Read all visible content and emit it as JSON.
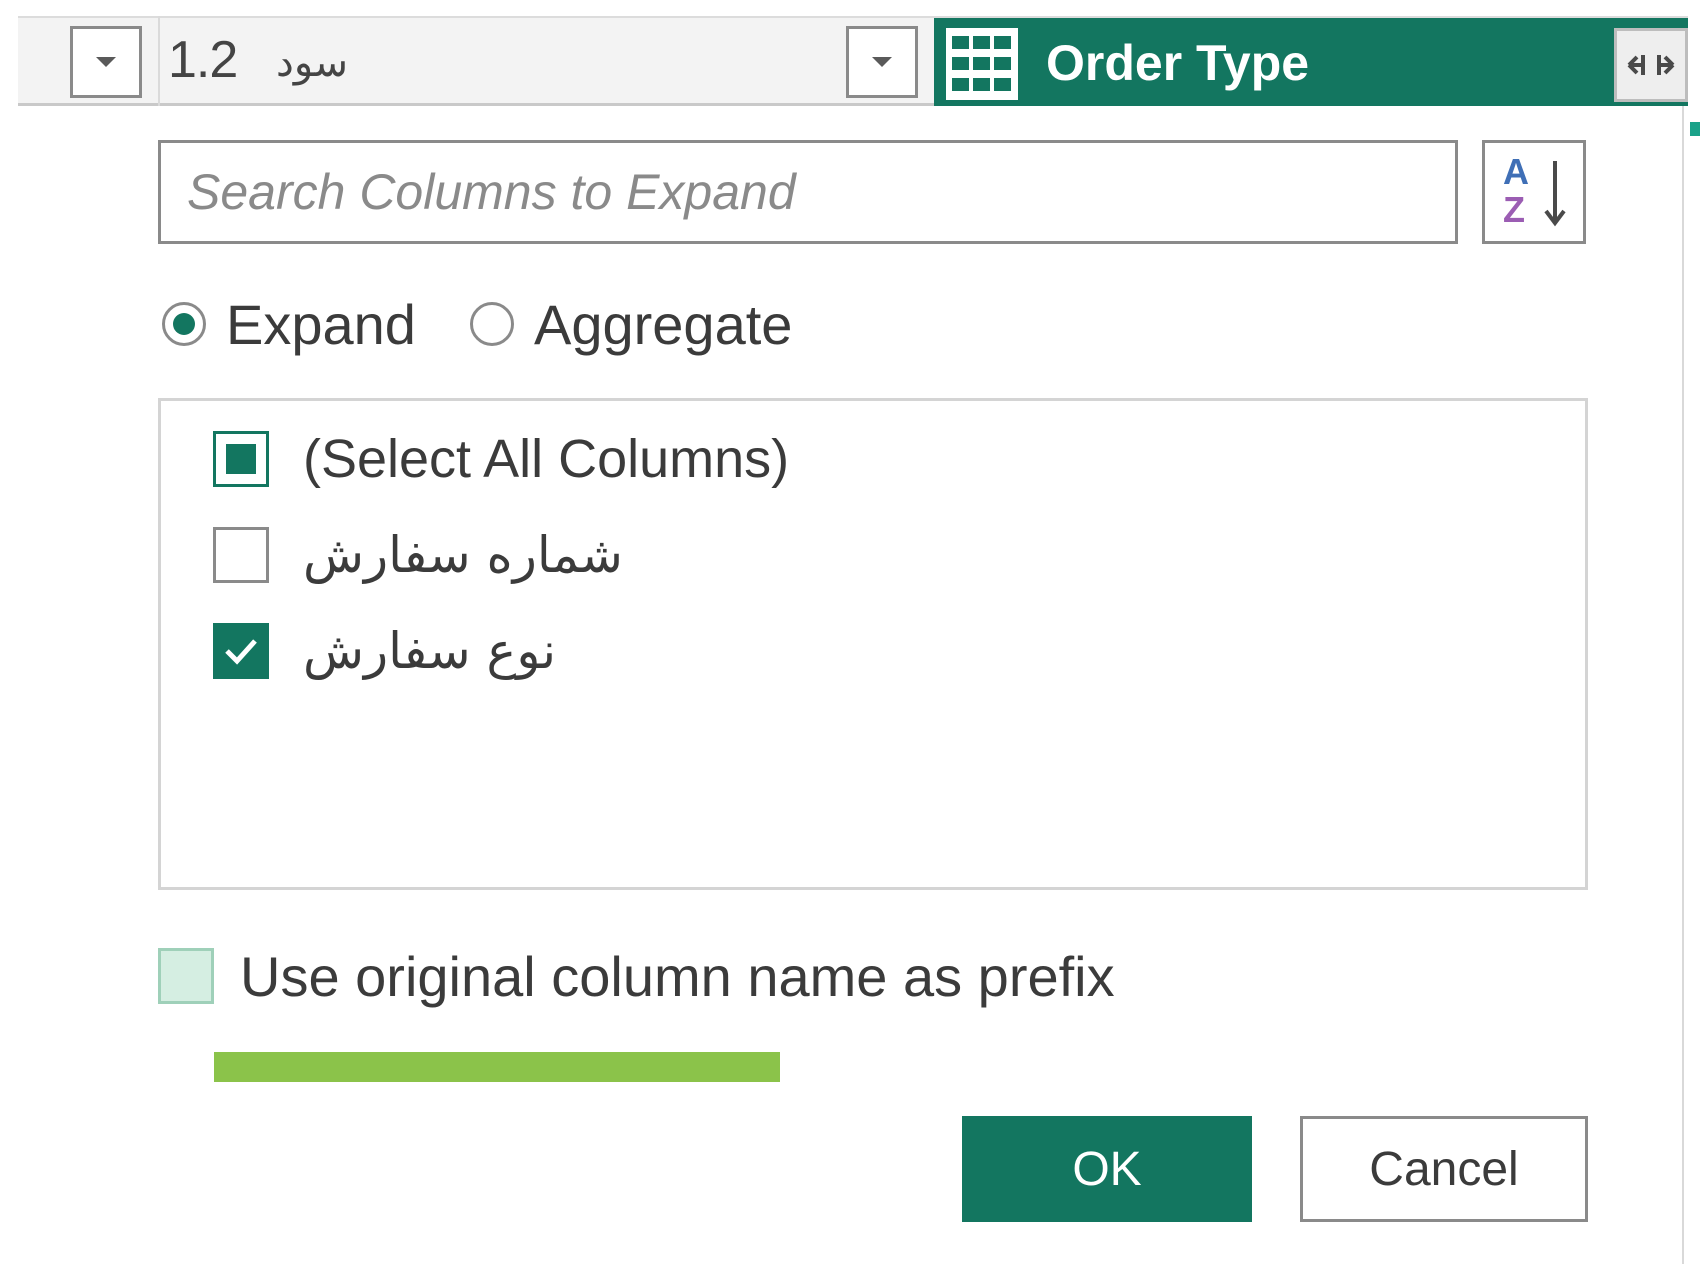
{
  "header": {
    "prev_column": {
      "type_label": "1.2",
      "name": "سود"
    },
    "active_column": {
      "title": "Order Type"
    },
    "icons": {
      "table": "table-icon",
      "expand": "expand-columns-icon",
      "dropdown": "chevron-down-icon"
    }
  },
  "dialog": {
    "search": {
      "placeholder": "Search Columns to Expand",
      "value": ""
    },
    "sort_icon": "sort-az-icon",
    "sort_text": {
      "a": "A",
      "z": "Z"
    },
    "mode": {
      "expand_label": "Expand",
      "aggregate_label": "Aggregate",
      "selected": "Expand"
    },
    "columns": [
      {
        "label": "(Select All Columns)",
        "state": "partial"
      },
      {
        "label": "شماره سفارش",
        "state": "unchecked"
      },
      {
        "label": "نوع سفارش",
        "state": "checked"
      }
    ],
    "prefix": {
      "label": "Use original column name as prefix",
      "checked": false
    },
    "progress": {
      "fraction": 0.56
    },
    "ok_label": "OK",
    "cancel_label": "Cancel"
  },
  "colors": {
    "accent": "#137660",
    "progress": "#8bc34a",
    "sort_a": "#3f6fb6",
    "sort_z": "#9b5db3"
  }
}
